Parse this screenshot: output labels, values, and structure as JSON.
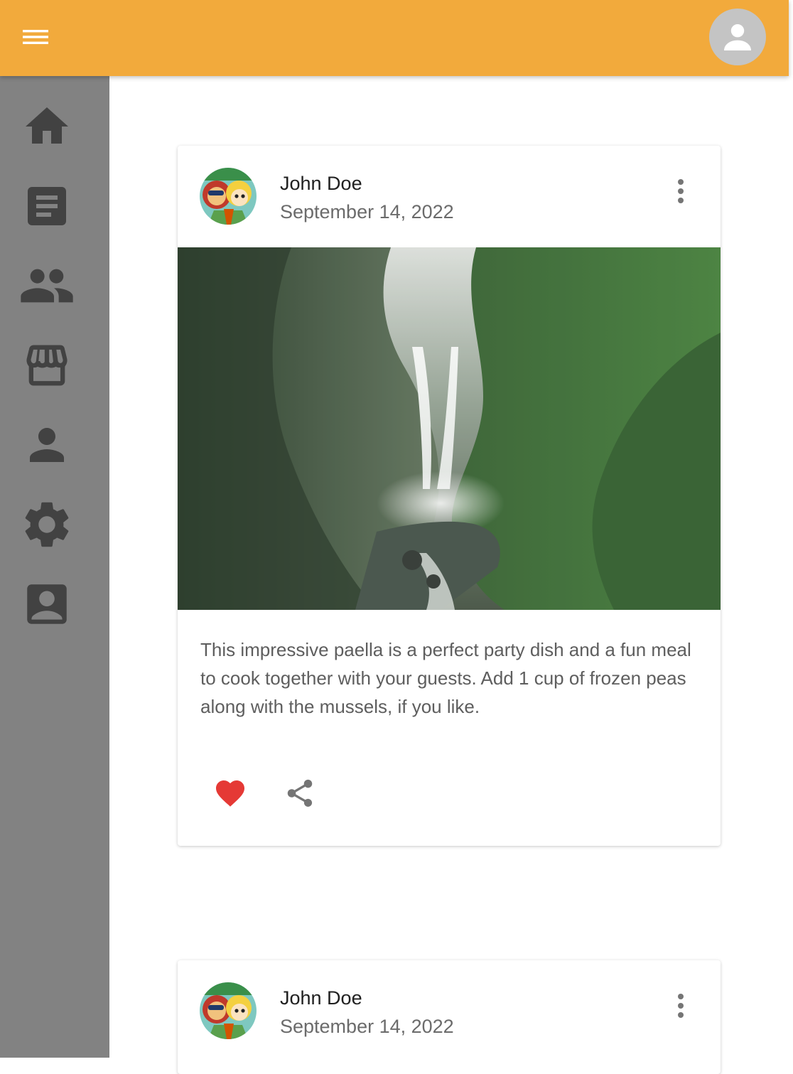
{
  "appbar": {
    "color": "#f2aa3c",
    "menu_icon": "hamburger-menu-icon",
    "account_icon": "account-circle-icon"
  },
  "sidebar": {
    "color": "#828282",
    "items": [
      {
        "icon": "home-icon"
      },
      {
        "icon": "article-icon"
      },
      {
        "icon": "people-icon"
      },
      {
        "icon": "store-icon"
      },
      {
        "icon": "person-icon"
      },
      {
        "icon": "settings-gear-icon"
      },
      {
        "icon": "contact-card-icon"
      }
    ]
  },
  "posts": [
    {
      "author": "John Doe",
      "date": "September 14, 2022",
      "text": "This impressive paella is a perfect party dish and a fun meal to cook together with your guests. Add 1 cup of frozen peas along with the mussels, if you like.",
      "image": "waterfall-photo",
      "liked": true,
      "like_color": "#e53935"
    },
    {
      "author": "John Doe",
      "date": "September 14, 2022"
    }
  ]
}
